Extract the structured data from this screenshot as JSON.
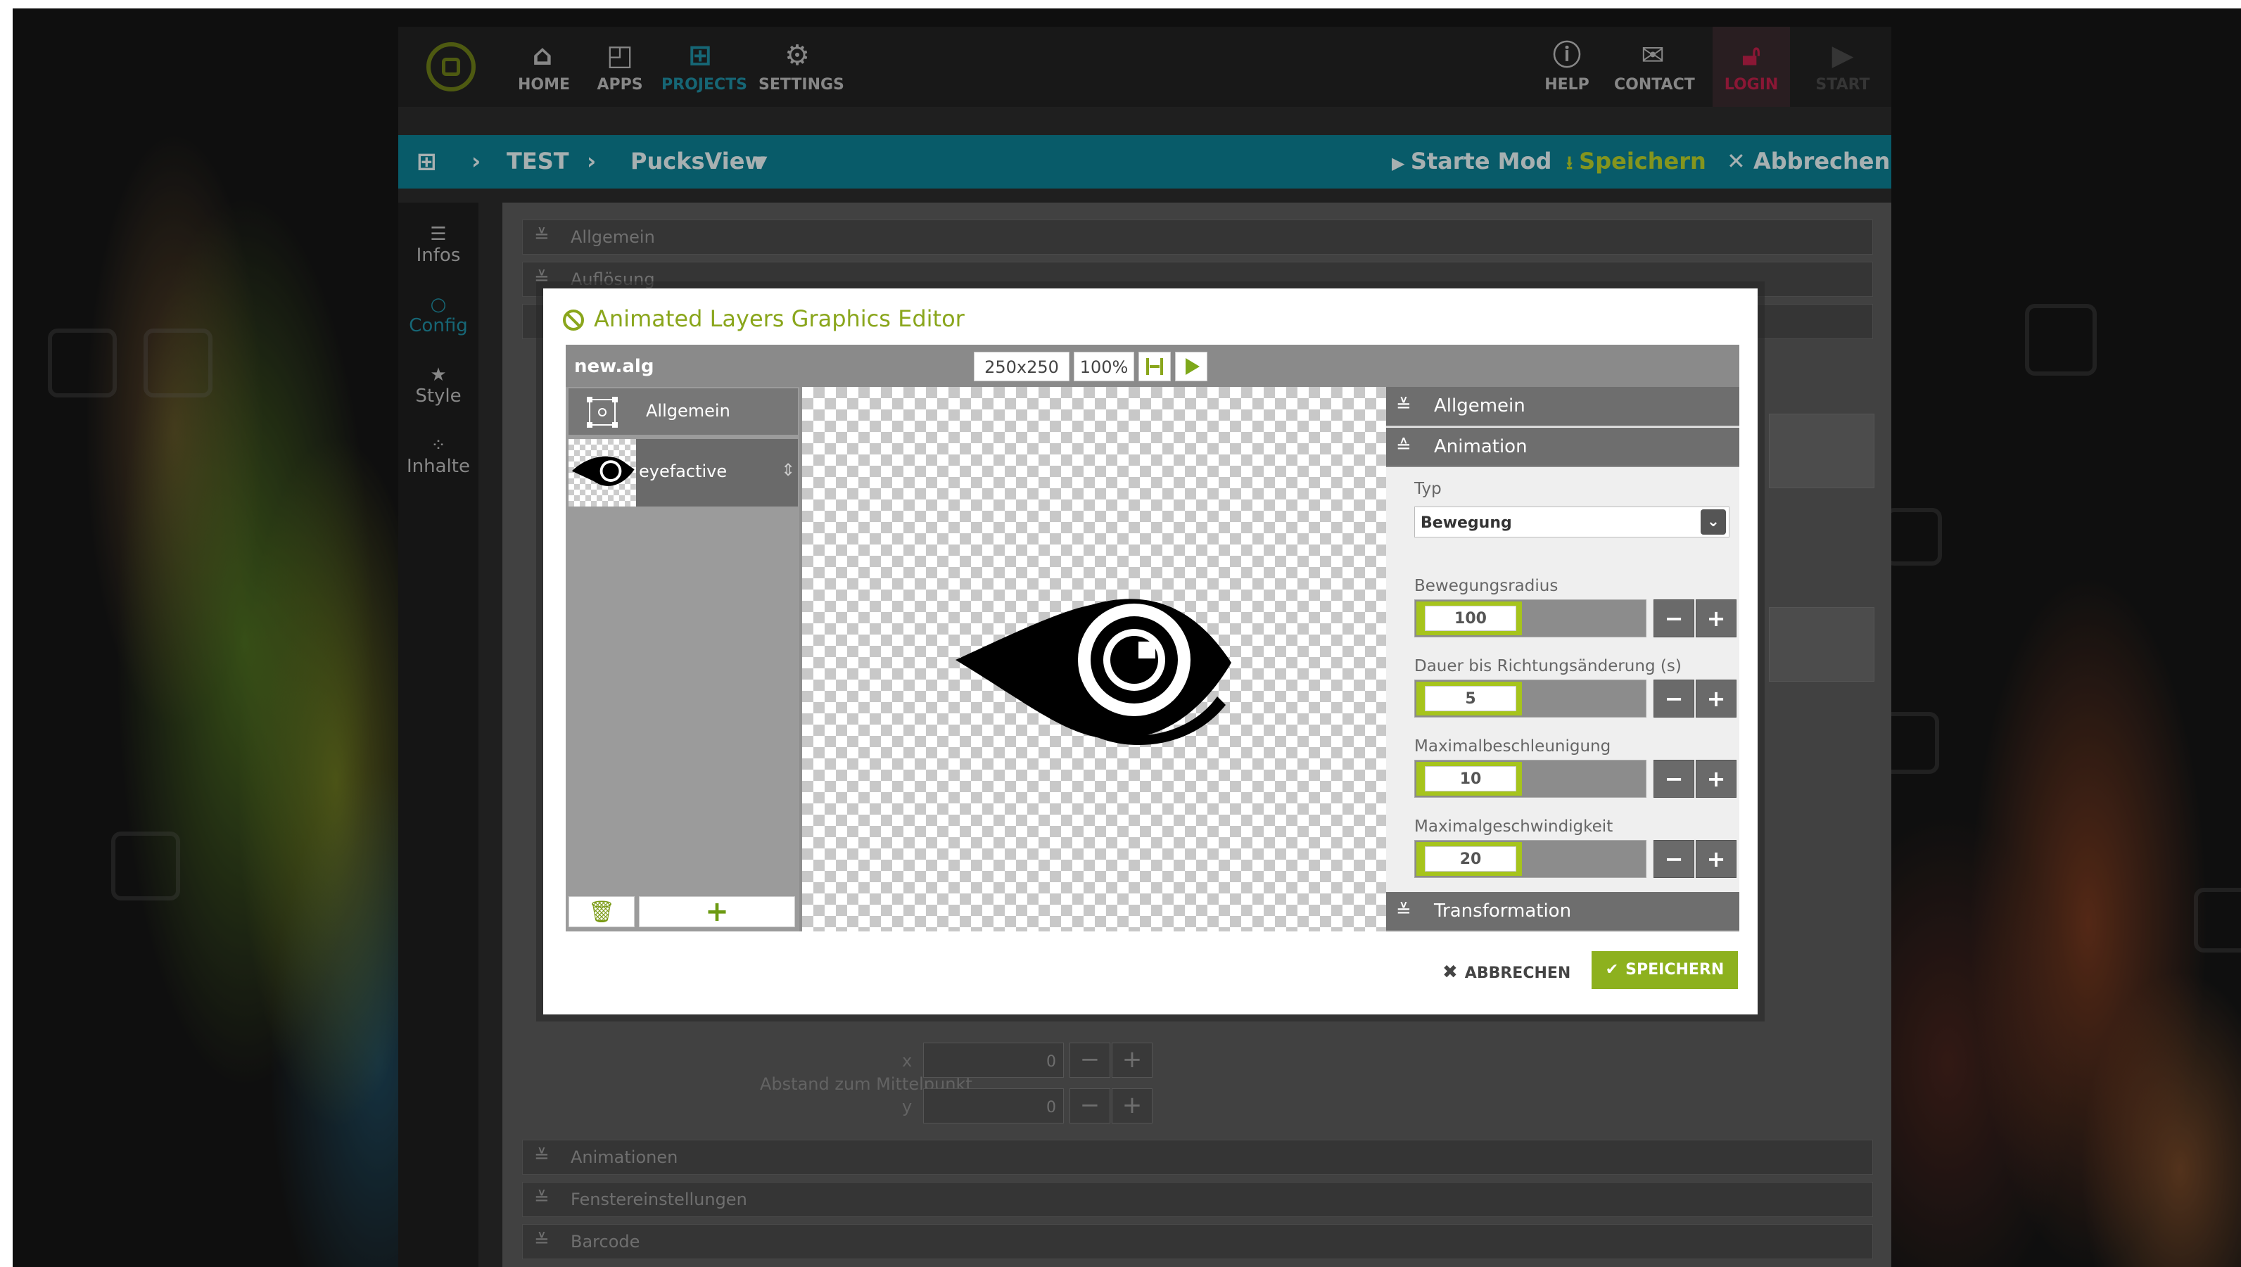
{
  "nav": {
    "items": [
      {
        "label": "HOME",
        "icon": "home-icon"
      },
      {
        "label": "APPS",
        "icon": "apps-icon"
      },
      {
        "label": "PROJECTS",
        "icon": "projects-icon"
      },
      {
        "label": "SETTINGS",
        "icon": "gear-icon"
      }
    ],
    "right": [
      {
        "label": "HELP",
        "icon": "help-icon"
      },
      {
        "label": "CONTACT",
        "icon": "mail-icon"
      },
      {
        "label": "LOGIN",
        "icon": "lock-icon"
      },
      {
        "label": "START",
        "icon": "play-icon"
      }
    ]
  },
  "breadcrumb": {
    "project": "TEST",
    "view": "PucksView"
  },
  "actions": {
    "start": "Starte Mod",
    "save": "Speichern",
    "cancel": "Abbrechen"
  },
  "leftnav": [
    "Infos",
    "Config",
    "Style",
    "Inhalte"
  ],
  "background_sections": {
    "top": [
      "Allgemein",
      "Auflösung"
    ],
    "bottom": [
      "Animationen",
      "Fenstereinstellungen",
      "Barcode"
    ],
    "distance_label": "Abstand zum Mittelpunkt",
    "x_label": "x",
    "y_label": "y",
    "x_value": "0",
    "y_value": "0"
  },
  "modal": {
    "title": "Animated Layers Graphics Editor",
    "file_name": "new.alg",
    "canvas_size": "250x250",
    "zoom": "100%",
    "layers": [
      {
        "name": "Allgemein",
        "icon": "general-layer-icon"
      },
      {
        "name": "eyefactive",
        "icon": "eye-thumbnail"
      }
    ],
    "props": {
      "section_general": "Allgemein",
      "section_animation": "Animation",
      "type_label": "Typ",
      "type_value": "Bewegung",
      "fields": [
        {
          "label": "Bewegungsradius",
          "value": "100"
        },
        {
          "label": "Dauer bis Richtungsänderung (s)",
          "value": "5"
        },
        {
          "label": "Maximalbeschleunigung",
          "value": "10"
        },
        {
          "label": "Maximalgeschwindigkeit",
          "value": "20"
        }
      ],
      "section_transformation": "Transformation"
    },
    "cancel_label": "ABBRECHEN",
    "save_label": "SPEICHERN"
  }
}
